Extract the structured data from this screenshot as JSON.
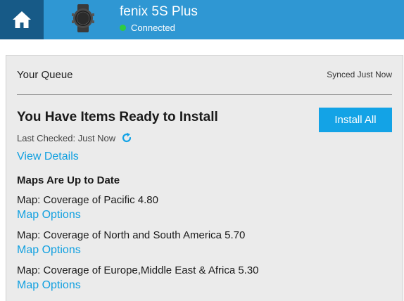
{
  "header": {
    "device_name": "fenix 5S Plus",
    "status": "Connected",
    "status_color": "#2ecc40",
    "home_icon": "home-icon",
    "device_icon": "smartwatch-icon",
    "bg_color": "#2f97d3",
    "home_bg_color": "#175a87"
  },
  "queue": {
    "title": "Your Queue",
    "synced": "Synced Just Now"
  },
  "ready": {
    "title": "You Have Items Ready to Install",
    "install_all_label": "Install All",
    "last_checked": "Last Checked: Just Now",
    "refresh_icon": "refresh-icon",
    "view_details": "View Details",
    "accent_color": "#13a3e6"
  },
  "maps": {
    "heading": "Maps Are Up to Date",
    "items": [
      {
        "name": "Map: Coverage of Pacific 4.80",
        "options_label": "Map Options"
      },
      {
        "name": "Map: Coverage of North and South America 5.70",
        "options_label": "Map Options"
      },
      {
        "name": "Map: Coverage of Europe,Middle East & Africa 5.30",
        "options_label": "Map Options"
      }
    ]
  }
}
